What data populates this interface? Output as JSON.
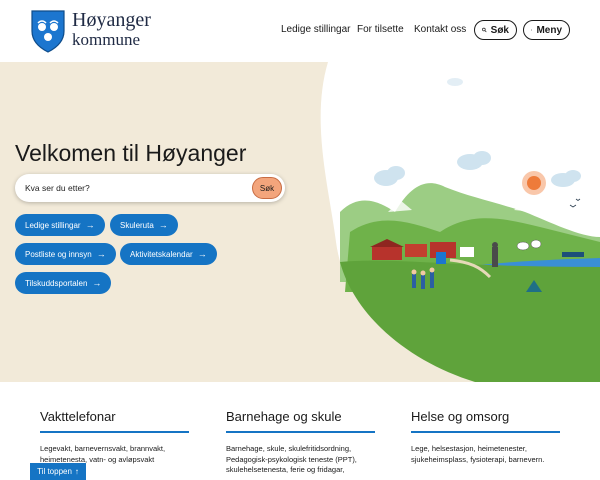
{
  "header": {
    "brand_line1": "Høyanger",
    "brand_line2": "kommune",
    "logo_icon": "coat-of-arms-icon",
    "nav": [
      {
        "label": "Ledige stillingar"
      },
      {
        "label": "For tilsette"
      },
      {
        "label": "Kontakt oss"
      }
    ],
    "search_label": "Søk",
    "menu_label": "Meny"
  },
  "hero": {
    "title": "Velkomen til Høyanger",
    "search_placeholder": "Kva ser du etter?",
    "search_button": "Søk",
    "quick_links": [
      {
        "label": "Ledige stillingar"
      },
      {
        "label": "Skuleruta"
      },
      {
        "label": "Postliste og innsyn"
      },
      {
        "label": "Aktivitetskalendar"
      },
      {
        "label": "Tilskuddsportalen"
      }
    ]
  },
  "columns": [
    {
      "title": "Vakttelefonar",
      "text": [
        "Legevakt, barnevernsvakt, brannvakt,",
        "heimetenesta, vatn- og avløpsvakt"
      ]
    },
    {
      "title": "Barnehage og skule",
      "text": [
        "Barnehage, skule, skulefritidsordning,",
        "Pedagogisk-psykologisk teneste (PPT),",
        "skulehelsetenesta, ferie og fridagar,"
      ]
    },
    {
      "title": "Helse og omsorg",
      "text": [
        "Lege, helsestasjon, heimetenester,",
        "sjukeheimsplass, fysioterapi, barnevern."
      ]
    }
  ],
  "back_to_top": "Til toppen",
  "colors": {
    "accent": "#1574c4",
    "hero_bg": "#f2ead9",
    "search_button": "#f3a57c",
    "grass": "#5fa33b"
  }
}
